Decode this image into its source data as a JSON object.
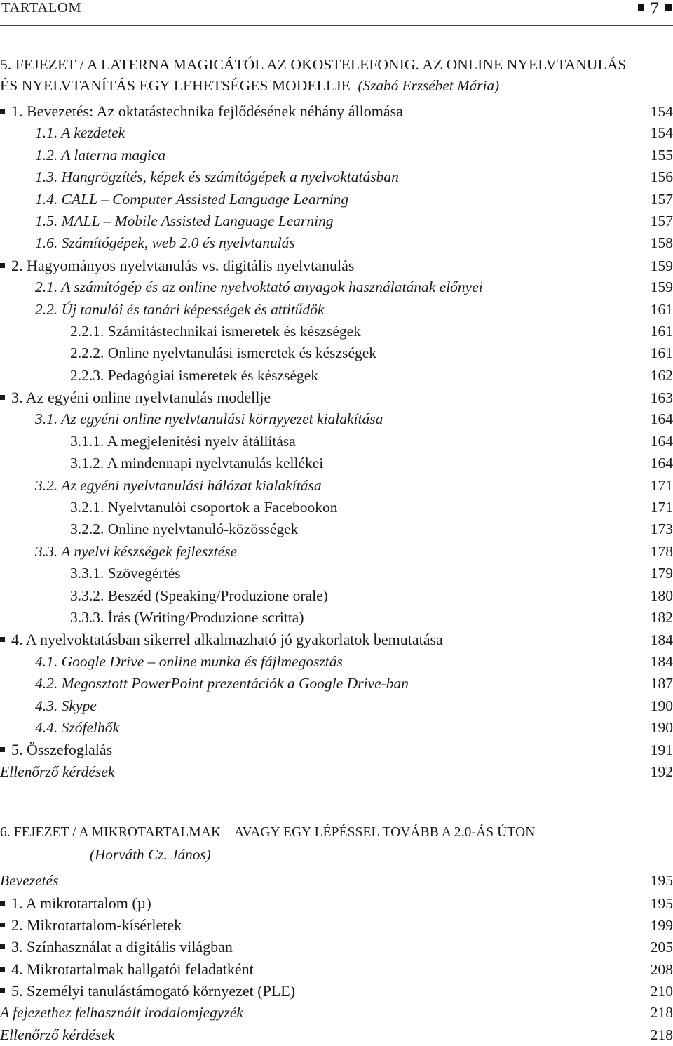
{
  "running_head": {
    "title": "TARTALOM",
    "folio": "7",
    "left_marker": "square-bullet",
    "right_marker": "square-bullet"
  },
  "chapters": [
    {
      "heading_lines": [
        "5. FEJEZET / A LATERNA MAGICÁTÓL AZ OKOSTELEFONIG. AZ ONLINE NYELVTANULÁS",
        "ÉS NYELVTANÍTÁS EGY LEHETSÉGES MODELLJE"
      ],
      "author": "(Szabó Erzsébet Mária)",
      "author_inline": true,
      "entries": [
        {
          "level": 1,
          "text": "1. Bevezetés: Az oktatástechnika fejlődésének néhány állomása",
          "page": "154"
        },
        {
          "level": 2,
          "text": "1.1. A kezdetek",
          "page": "154"
        },
        {
          "level": 2,
          "text": "1.2. A laterna magica",
          "page": "155"
        },
        {
          "level": 2,
          "text": "1.3. Hangrögzítés, képek és számítógépek a nyelvoktatásban",
          "page": "156"
        },
        {
          "level": 2,
          "text": "1.4. CALL – Computer Assisted Language Learning",
          "page": "157"
        },
        {
          "level": 2,
          "text": "1.5. MALL – Mobile Assisted Language Learning",
          "page": "157"
        },
        {
          "level": 2,
          "text": "1.6. Számítógépek, web 2.0 és nyelvtanulás",
          "page": "158"
        },
        {
          "level": 1,
          "text": "2. Hagyományos nyelvtanulás vs. digitális nyelvtanulás",
          "page": "159"
        },
        {
          "level": 2,
          "text": "2.1. A számítógép és az online nyelvoktató anyagok használatának előnyei",
          "page": "159"
        },
        {
          "level": 2,
          "text": "2.2. Új tanulói és tanári képességek és attitűdök",
          "page": "161"
        },
        {
          "level": 3,
          "text": "2.2.1. Számítástechnikai ismeretek és készségek",
          "page": "161"
        },
        {
          "level": 3,
          "text": "2.2.2. Online nyelvtanulási ismeretek és készségek",
          "page": "161"
        },
        {
          "level": 3,
          "text": "2.2.3. Pedagógiai ismeretek és készségek",
          "page": "162"
        },
        {
          "level": 1,
          "text": "3. Az egyéni online nyelvtanulás modellje",
          "page": "163"
        },
        {
          "level": 2,
          "text": "3.1. Az egyéni online nyelvtanulási környyezet kialakítása",
          "page": "164"
        },
        {
          "level": 3,
          "text": "3.1.1. A megjelenítési nyelv átállítása",
          "page": "164"
        },
        {
          "level": 3,
          "text": "3.1.2. A mindennapi nyelvtanulás kellékei",
          "page": "164"
        },
        {
          "level": 2,
          "text": "3.2. Az egyéni nyelvtanulási hálózat kialakítása",
          "page": "171"
        },
        {
          "level": 3,
          "text": "3.2.1. Nyelvtanulói csoportok a Facebookon",
          "page": "171"
        },
        {
          "level": 3,
          "text": "3.2.2. Online nyelvtanuló-közösségek",
          "page": "173"
        },
        {
          "level": 2,
          "text": "3.3. A nyelvi készségek fejlesztése",
          "page": "178"
        },
        {
          "level": 3,
          "text": "3.3.1. Szövegértés",
          "page": "179"
        },
        {
          "level": 3,
          "text": "3.3.2. Beszéd (Speaking/Produzione orale)",
          "page": "180"
        },
        {
          "level": 3,
          "text": "3.3.3. Írás (Writing/Produzione scritta)",
          "page": "182"
        },
        {
          "level": 1,
          "text": "4. A nyelvoktatásban sikerrel alkalmazható jó gyakorlatok bemutatása",
          "page": "184"
        },
        {
          "level": 2,
          "text": "4.1. Google Drive – online munka és fájlmegosztás",
          "page": "184"
        },
        {
          "level": 2,
          "text": "4.2. Megosztott PowerPoint prezentációk a Google Drive-ban",
          "page": "187"
        },
        {
          "level": 2,
          "text": "4.3. Skype",
          "page": "190"
        },
        {
          "level": 2,
          "text": "4.4. Szófelhők",
          "page": "190"
        },
        {
          "level": 1,
          "text": "5. Összefoglalás",
          "page": "191"
        },
        {
          "level": 0,
          "text": "Ellenőrző kérdések",
          "page": "192"
        }
      ]
    },
    {
      "heading_lines": [
        "6. FEJEZET / A MIKROTARTALMAK – AVAGY EGY LÉPÉSSEL TOVÁBB A 2.0-ÁS ÚTON"
      ],
      "author": "(Horváth Cz. János)",
      "author_inline": false,
      "entries": [
        {
          "level": 0,
          "text": "Bevezetés",
          "page": "195"
        },
        {
          "level": 1,
          "text": "1. A mikrotartalom (µ)",
          "page": "195"
        },
        {
          "level": 1,
          "text": "2. Mikrotartalom-kísérletek",
          "page": "199"
        },
        {
          "level": 1,
          "text": "3. Színhasználat a digitális világban",
          "page": "205"
        },
        {
          "level": 1,
          "text": "4. Mikrotartalmak hallgatói feladatként",
          "page": "208"
        },
        {
          "level": 1,
          "text": "5. Személyi tanulástámogató környezet (PLE)",
          "page": "210",
          "small_caps_tail": "PLE"
        },
        {
          "level": 0,
          "text": "A fejezethez felhasznált irodalomjegyzék",
          "page": "218"
        },
        {
          "level": 0,
          "text": "Ellenőrző kérdések",
          "page": "218"
        }
      ]
    }
  ],
  "colors": {
    "text": "#1a1a1a",
    "rule": "#3a3f52",
    "background": "#ffffff"
  }
}
